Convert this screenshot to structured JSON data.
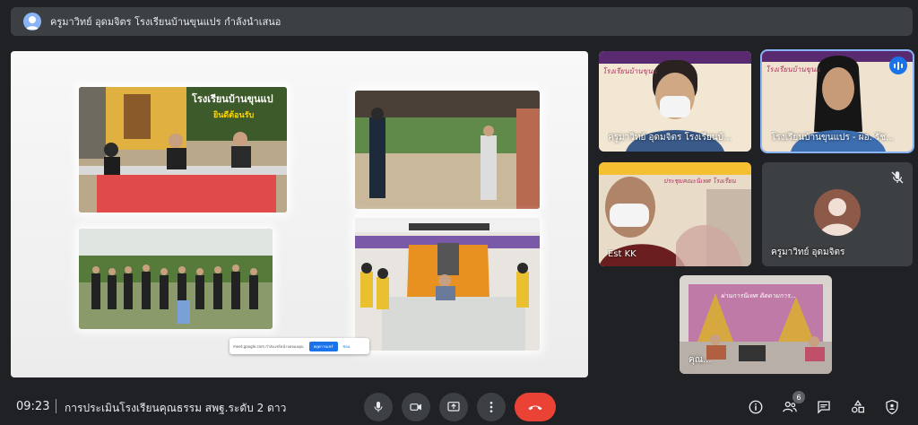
{
  "presenter": {
    "banner": "ครูมาวิทย์ อุดมจิตร โรงเรียนบ้านขุนแปร กำลังนำเสนอ"
  },
  "screen_share": {
    "photo_1_sign": "โรงเรียนบ้านขุนแป",
    "photo_1_sign2": "ยินดีต้อนรับ",
    "chip_text": "meet.google.com กำลังแชร์หน้าจอของคุณ",
    "chip_stop": "หยุดการแชร์",
    "chip_hide": "ซ่อน"
  },
  "participants": [
    {
      "name": "ครูมาวิทย์ อุดมจิตร โรงเรียนบ้...",
      "banner": "โรงเรียนบ้านขุนแ"
    },
    {
      "name": "โรงเรียนบ้านขุนแปร - ผอ. รัช...",
      "banner": "โรงเรียนบ้านขุนแ"
    },
    {
      "name": "Est KK",
      "banner": "ประชุมคณะนิเทศ โรงเรียน"
    },
    {
      "name": "ครูมาวิทย์ อุดมจิตร"
    },
    {
      "name": "คุณ...",
      "banner": "ผ่านการนิเทศ ติดตามการ..."
    }
  ],
  "bottom_bar": {
    "time": "09:23",
    "meeting_title": "การประเมินโรงเรียนคุณธรรม สพฐ.ระดับ 2 ดาว",
    "people_count": "6"
  },
  "colors": {
    "background": "#202124",
    "surface": "#3c4043",
    "accent": "#8ab4f8",
    "end_call": "#ea4335"
  },
  "icons": [
    "user-avatar-icon",
    "mic-icon",
    "camera-icon",
    "present-icon",
    "more-icon",
    "end-call-icon",
    "info-icon",
    "people-icon",
    "chat-icon",
    "activities-icon",
    "host-controls-icon",
    "mic-off-icon"
  ]
}
